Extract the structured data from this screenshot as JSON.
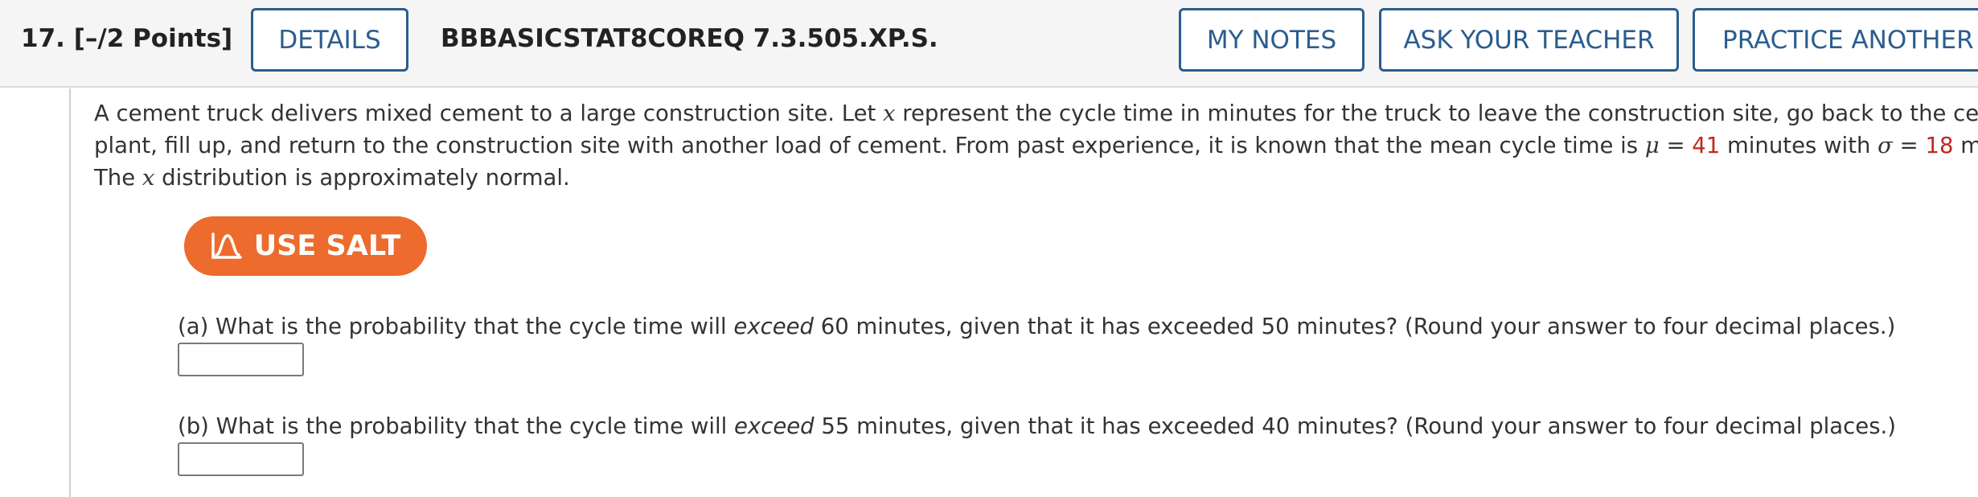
{
  "header": {
    "question_label": "17.  [–/2 Points]",
    "details_label": "DETAILS",
    "question_code": "BBBASICSTAT8COREQ 7.3.505.XP.S.",
    "my_notes_label": "MY NOTES",
    "ask_teacher_label": "ASK YOUR TEACHER",
    "practice_label": "PRACTICE ANOTHER"
  },
  "problem": {
    "line1_pre": "A cement truck delivers mixed cement to a large construction site. Let ",
    "line1_var": "x",
    "line1_post": " represent the cycle time in minutes for the truck to leave the construction site, go back to the cement",
    "line2_pre": "plant, fill up, and return to the construction site with another load of cement. From past experience, it is known that the mean cycle time is ",
    "mu_symbol": "μ",
    "equals1": " = ",
    "mu_value": "41",
    "line2_mid": " minutes with ",
    "sigma_symbol": "σ",
    "equals2": " = ",
    "sigma_value": "18",
    "line2_post": " minutes.",
    "line3_pre": "The ",
    "line3_var": "x",
    "line3_post": " distribution is approximately normal."
  },
  "salt": {
    "label": "USE SALT",
    "icon": "salt-distribution-icon"
  },
  "parts": [
    {
      "pre": "(a) What is the probability that the cycle time will ",
      "emph": "exceed",
      "post": " 60 minutes, given that it has exceeded 50 minutes? (Round your answer to four decimal places.)",
      "answer": ""
    },
    {
      "pre": "(b) What is the probability that the cycle time will ",
      "emph": "exceed",
      "post": " 55 minutes, given that it has exceeded 40 minutes? (Round your answer to four decimal places.)",
      "answer": ""
    }
  ],
  "colors": {
    "accent_blue": "#2a5d8f",
    "salt_orange": "#ec6b2d",
    "value_red": "#c0271d"
  }
}
